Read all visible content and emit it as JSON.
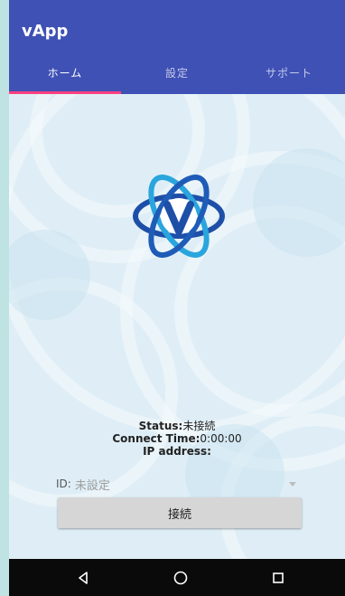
{
  "app": {
    "title": "vApp"
  },
  "tabs": [
    {
      "label": "ホーム",
      "selected": true
    },
    {
      "label": "設定",
      "selected": false
    },
    {
      "label": "サポート",
      "selected": false
    }
  ],
  "status": {
    "status_label": "Status:",
    "status_value": "未接続",
    "connect_time_label": "Connect Time:",
    "connect_time_value": "0:00:00",
    "ip_label": "IP address:",
    "ip_value": ""
  },
  "id_select": {
    "label": "ID:",
    "value": "未設定"
  },
  "connect_button": {
    "label": "接続"
  },
  "nav": {
    "back_icon": "back-icon",
    "home_icon": "home-icon",
    "recent_icon": "recent-apps-icon"
  },
  "colors": {
    "primary": "#3f51b5",
    "accent": "#ff4081",
    "logo_dark": "#1e4fa8",
    "logo_light": "#2aa5dd"
  }
}
